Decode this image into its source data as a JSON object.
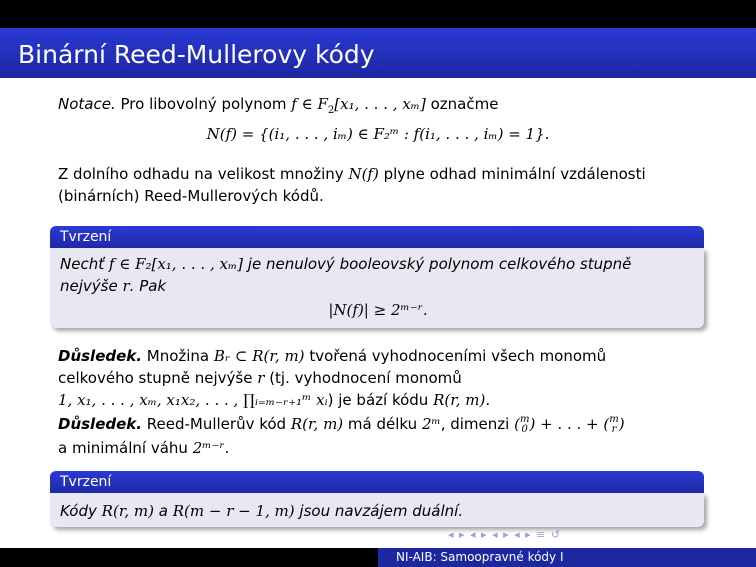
{
  "slide": {
    "title": "Binární Reed-Mullerovy kódy"
  },
  "notace": {
    "label": "Notace.",
    "text": "Pro libovolný polynom",
    "formula_f": "f ∈ F",
    "vars": "[x₁, . . . , xₘ]",
    "oznacme": "označme"
  },
  "nf_def": "N(f) = {(i₁, . . . , iₘ) ∈ F₂ᵐ : f(i₁, . . . , iₘ) = 1}.",
  "para1": {
    "line1_a": "Z dolního odhadu na velikost množiny",
    "line1_b": "N(f)",
    "line1_c": "plyne odhad minimální vzdálenosti",
    "line2": "(binárních) Reed-Mullerových kódů."
  },
  "block1": {
    "header": "Tvrzení",
    "line1_a": "Nechť",
    "line1_b": "f ∈ F₂[x₁, . . . , xₘ]",
    "line1_c": "je nenulový booleovský polynom celkového stupně",
    "line2_a": "nejvýše",
    "line2_b": "r",
    "line2_c": ". Pak",
    "formula": "|N(f)| ≥ 2ᵐ⁻ʳ."
  },
  "dusledek1": {
    "label": "Důsledek.",
    "line1_a": "Množina",
    "line1_b": "Bᵣ ⊂ R(r, m)",
    "line1_c": "tvořená vyhodnoceními všech monomů",
    "line2_a": "celkového stupně nejvýše",
    "line2_b": "r",
    "line2_c": "(tj. vyhodnocení monomů",
    "line3_a": "1, x₁, . . . , xₘ, x₁x₂, . . . , ∏ᵢ₌ₘ₋ᵣ₊₁ᵐ xᵢ",
    "line3_b": ") je bází kódu",
    "line3_c": "R(r, m)."
  },
  "dusledek2": {
    "label": "Důsledek.",
    "line1_a": "Reed-Mullerův kód",
    "line1_b": "R(r, m)",
    "line1_c": "má délku",
    "line1_d": "2ᵐ",
    "line1_e": ", dimenzi",
    "line1_f": "+ . . . +",
    "line2_a": "a minimální váhu",
    "line2_b": "2ᵐ⁻ʳ."
  },
  "block2": {
    "header": "Tvrzení",
    "line1_a": "Kódy",
    "line1_b": "R(r, m)",
    "line1_c": "a",
    "line1_d": "R(m − r − 1, m)",
    "line1_e": "jsou navzájem duální."
  },
  "footer": {
    "text": "NI-AIB: Samoopravné kódy I"
  }
}
